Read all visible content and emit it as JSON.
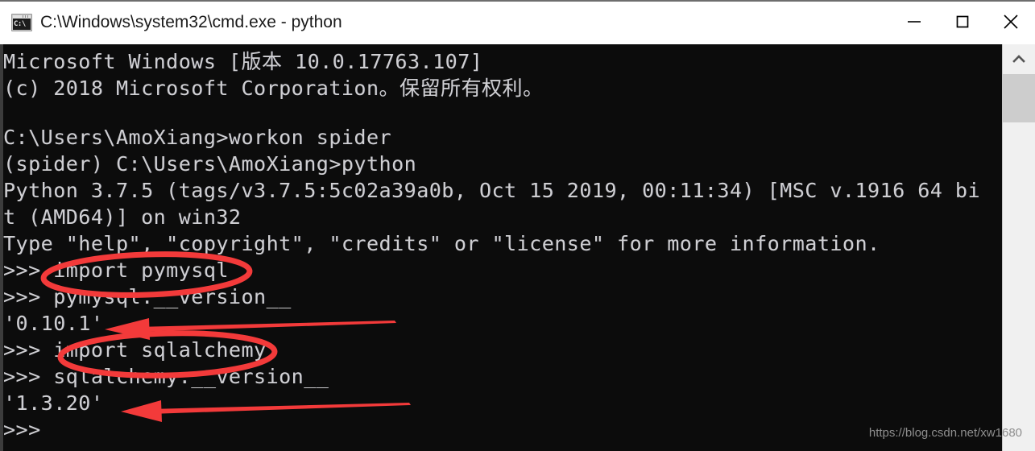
{
  "window": {
    "title": "C:\\Windows\\system32\\cmd.exe - python",
    "icon": "cmd-console-icon",
    "icon_text": "C:\\",
    "controls": {
      "minimize_label": "Minimize",
      "maximize_label": "Maximize",
      "close_label": "Close"
    }
  },
  "terminal": {
    "lines": [
      "Microsoft Windows [版本 10.0.17763.107]",
      "(c) 2018 Microsoft Corporation。保留所有权利。",
      "",
      "C:\\Users\\AmoXiang>workon spider",
      "(spider) C:\\Users\\AmoXiang>python",
      "Python 3.7.5 (tags/v3.7.5:5c02a39a0b, Oct 15 2019, 00:11:34) [MSC v.1916 64 bi",
      "t (AMD64)] on win32",
      "Type \"help\", \"copyright\", \"credits\" or \"license\" for more information.",
      ">>> import pymysql",
      ">>> pymysql.__version__",
      "'0.10.1'",
      ">>> import sqlalchemy",
      ">>> sqlalchemy.__version__",
      "'1.3.20'",
      ">>>"
    ]
  },
  "annotations": {
    "color": "#f33a3a",
    "highlight_1": "import pymysql",
    "highlight_2": "import sqlalchemy",
    "arrow_1_target": "'0.10.1'",
    "arrow_2_target": "'1.3.20'"
  },
  "watermark": {
    "text": "https://blog.csdn.net/xw1680"
  },
  "scrollbar": {
    "up_arrow": "chevron-up-icon"
  }
}
